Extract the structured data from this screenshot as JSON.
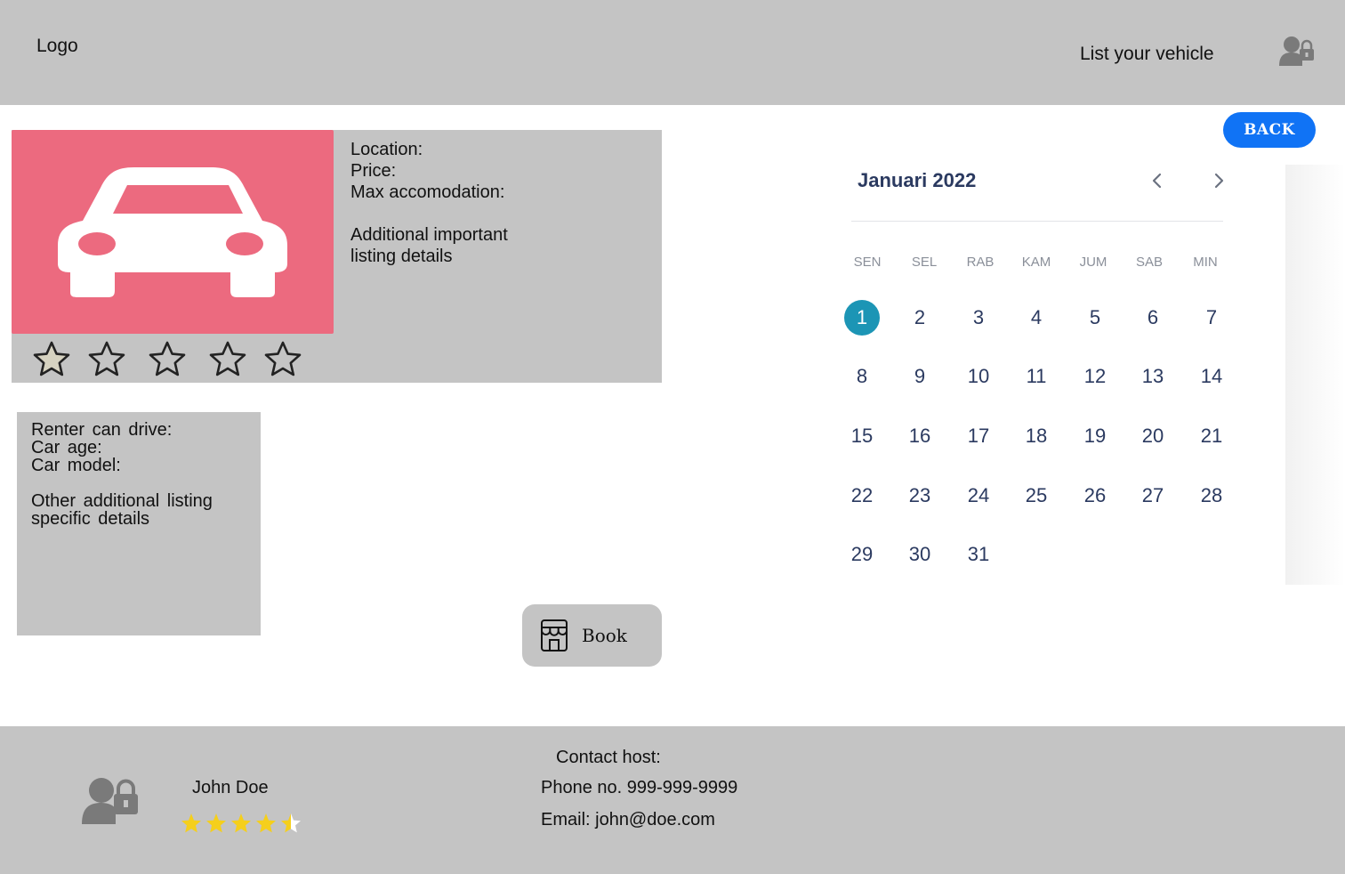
{
  "header": {
    "logo": "Logo",
    "list_vehicle": "List your vehicle",
    "user_icon": "user-lock-icon"
  },
  "back_button": {
    "label": "BACK",
    "color": "#1073f5"
  },
  "listing": {
    "image_icon": "car-icon",
    "image_bg": "#ec6a7f",
    "location_label": "Location:",
    "price_label": "Price:",
    "max_accommodation_label": "Max accomodation:",
    "additional_line1": "Additional important",
    "additional_line2": "listing details",
    "rating_stars": 5,
    "rating_value": 0
  },
  "details": {
    "renter_can_drive": "Renter can drive:",
    "car_age": "Car age:",
    "car_model": "Car model:",
    "other_line1": "Other additional listing",
    "other_line2": "specific details"
  },
  "book_button": {
    "label": "Book",
    "icon": "store-icon"
  },
  "calendar": {
    "month_title": "Januari 2022",
    "weekdays": [
      "SEN",
      "SEL",
      "RAB",
      "KAM",
      "JUM",
      "SAB",
      "MIN"
    ],
    "days": [
      "1",
      "2",
      "3",
      "4",
      "5",
      "6",
      "7",
      "8",
      "9",
      "10",
      "11",
      "12",
      "13",
      "14",
      "15",
      "16",
      "17",
      "18",
      "19",
      "20",
      "21",
      "22",
      "23",
      "24",
      "25",
      "26",
      "27",
      "28",
      "29",
      "30",
      "31"
    ],
    "selected_day": "1",
    "selected_color": "#1c95b5"
  },
  "footer": {
    "host_icon": "user-lock-icon",
    "host_name": "John Doe",
    "host_rating": 4.5,
    "contact_label": "Contact host:",
    "phone": "Phone no. 999-999-9999",
    "email": "Email: john@doe.com",
    "star_color": "#f5cf1c"
  }
}
